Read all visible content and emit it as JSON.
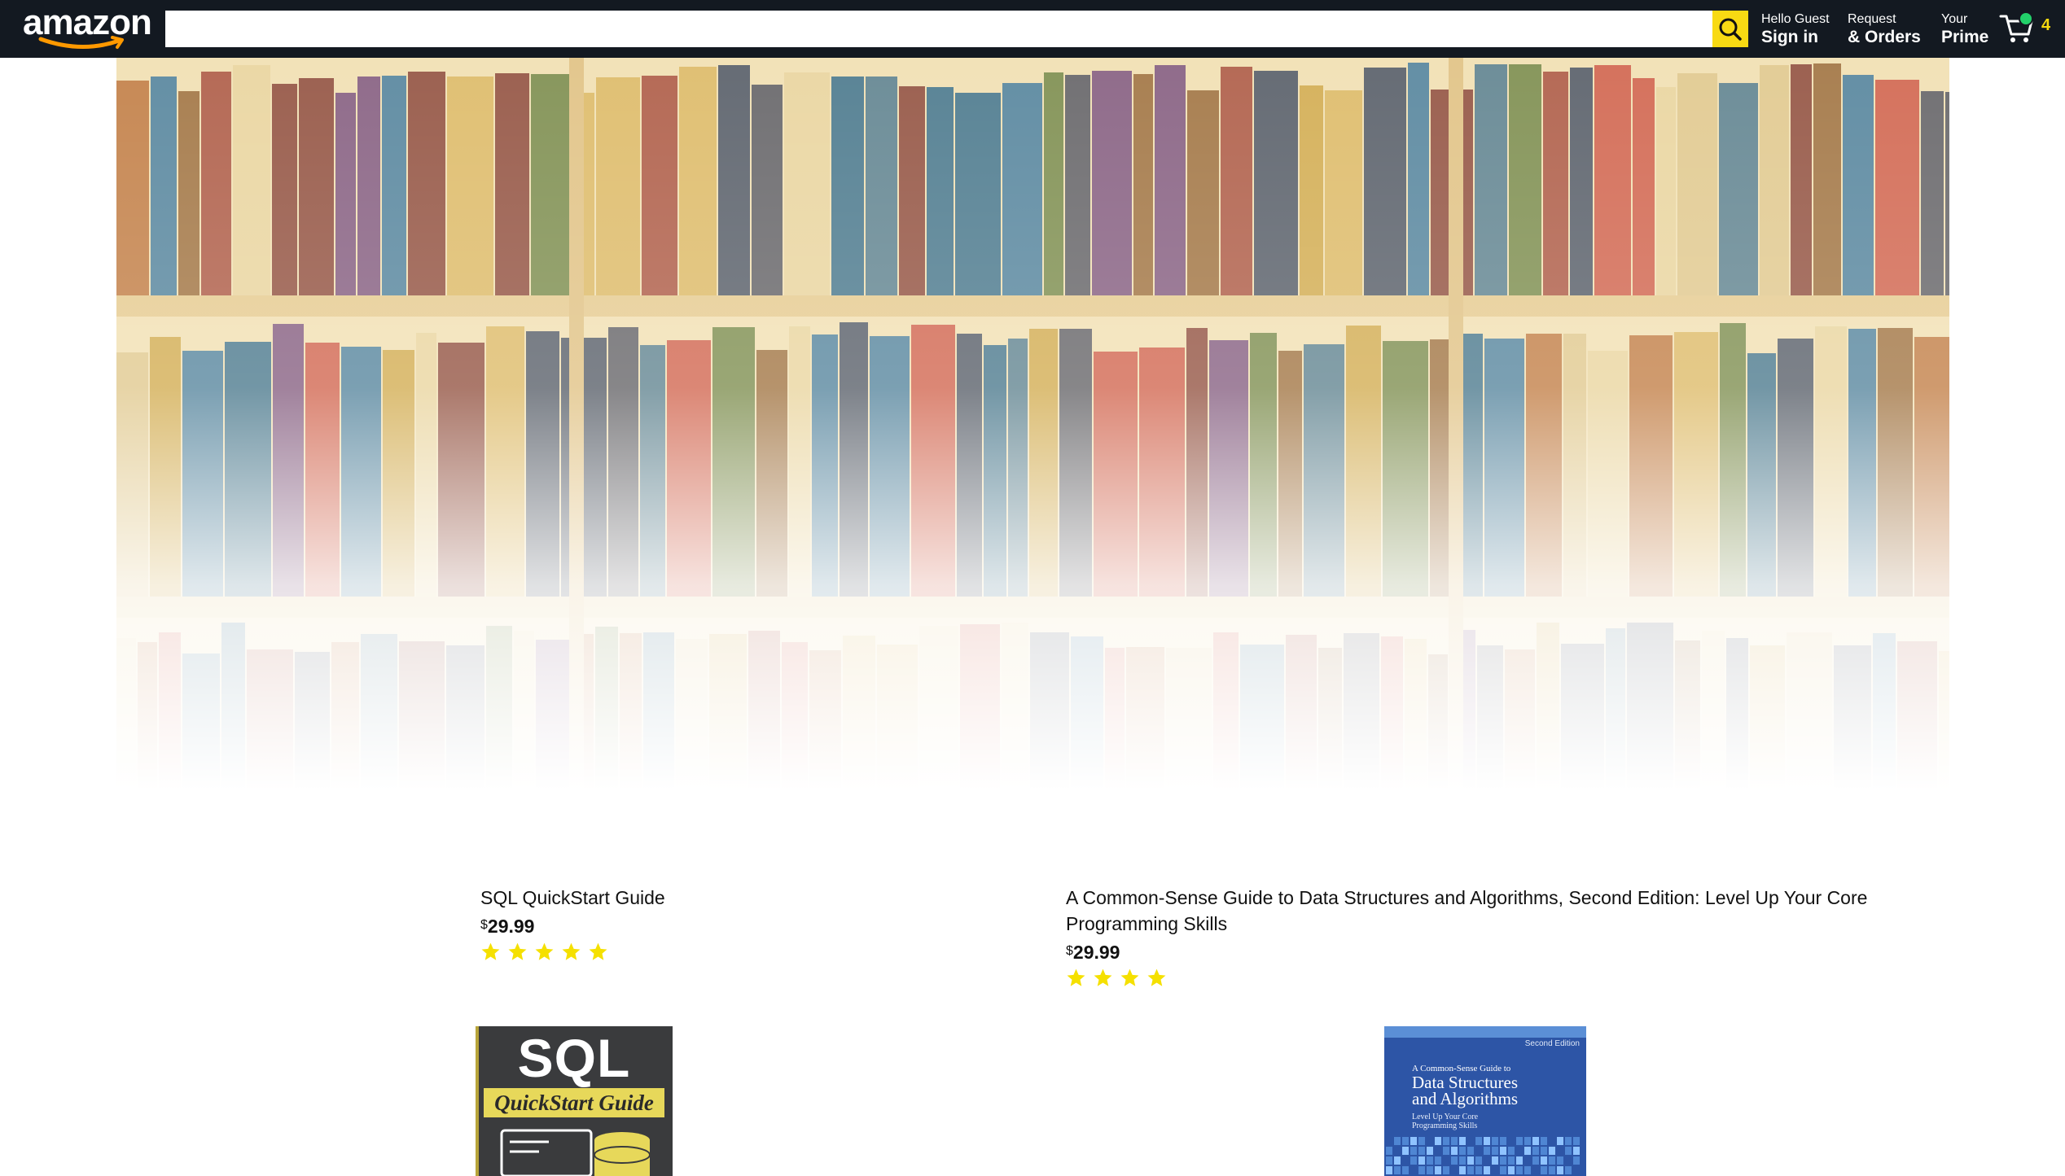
{
  "nav": {
    "logo_text": "amazon",
    "search": {
      "placeholder": "",
      "value": ""
    },
    "account": {
      "line1": "Hello Guest",
      "line2": "Sign in"
    },
    "orders": {
      "line1": "Request",
      "line2": "& Orders"
    },
    "prime": {
      "line1": "Your",
      "line2": "Prime"
    },
    "cart": {
      "count": "4"
    }
  },
  "colors": {
    "nav_bg": "#131921",
    "search_button": "#f8da13",
    "star": "#f5e000",
    "cart_count": "#f5d90f"
  },
  "banner": {
    "alt": "bookshelf"
  },
  "products": [
    {
      "title": "SQL QuickStart Guide",
      "currency": "$",
      "price": "29.99",
      "rating": 5,
      "cover": {
        "line1": "SQL",
        "line2": "QuickStart Guide"
      }
    },
    {
      "title": "A Common-Sense Guide to Data Structures and Algorithms, Second Edition: Level Up Your Core Programming Skills",
      "currency": "$",
      "price": "29.99",
      "rating": 4,
      "cover": {
        "edition": "Second Edition",
        "line1": "A Common-Sense Guide to",
        "line2": "Data Structures",
        "line3": "and Algorithms",
        "line4": "Level Up Your Core",
        "line5": "Programming Skills"
      }
    }
  ]
}
